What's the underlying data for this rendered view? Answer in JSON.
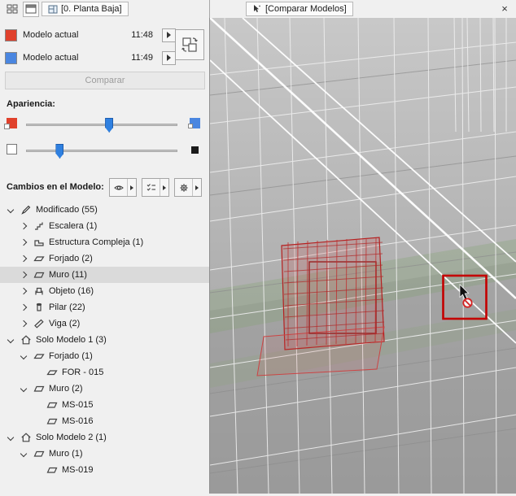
{
  "window": {
    "left_tab": "[0. Planta Baja]",
    "right_tab": "[Comparar Modelos]",
    "close_label": "×"
  },
  "models": {
    "rows": [
      {
        "name": "Modelo actual",
        "time": "11:48",
        "color": "#e0412c"
      },
      {
        "name": "Modelo actual",
        "time": "11:49",
        "color": "#4a86e0"
      }
    ],
    "compare_button": "Comparar"
  },
  "appearance": {
    "label": "Apariencia:",
    "thumb_color": "#2f80e0",
    "sliders": [
      {
        "name": "color-intensity",
        "value_pct": 55,
        "left_color": "#e0412c",
        "right_color": "#4a86e0"
      },
      {
        "name": "transparency",
        "value_pct": 22,
        "left_color": "#ffffff",
        "right_color": "#1a1a1a"
      }
    ]
  },
  "changes": {
    "label": "Cambios en el Modelo:",
    "buttons": [
      {
        "icon": "highlight-changes-icon"
      },
      {
        "icon": "list-filter-icon"
      },
      {
        "icon": "settings-gear-icon"
      }
    ]
  },
  "tree": {
    "items": [
      {
        "label": "Modificado (55)",
        "depth": 0,
        "expand": "expanded",
        "icon": "pencil-icon"
      },
      {
        "label": "Escalera (1)",
        "depth": 1,
        "expand": "collapsed",
        "icon": "stair-icon"
      },
      {
        "label": "Estructura Compleja (1)",
        "depth": 1,
        "expand": "collapsed",
        "icon": "complex-structure-icon"
      },
      {
        "label": "Forjado (2)",
        "depth": 1,
        "expand": "collapsed",
        "icon": "slab-icon"
      },
      {
        "label": "Muro (11)",
        "depth": 1,
        "expand": "collapsed",
        "icon": "wall-icon",
        "selected": true
      },
      {
        "label": "Objeto (16)",
        "depth": 1,
        "expand": "collapsed",
        "icon": "object-icon"
      },
      {
        "label": "Pilar (22)",
        "depth": 1,
        "expand": "collapsed",
        "icon": "column-icon"
      },
      {
        "label": "Viga (2)",
        "depth": 1,
        "expand": "collapsed",
        "icon": "beam-icon"
      },
      {
        "label": "Solo Modelo 1 (3)",
        "depth": 0,
        "expand": "expanded",
        "icon": "model-icon"
      },
      {
        "label": "Forjado (1)",
        "depth": 1,
        "expand": "expanded",
        "icon": "slab-icon"
      },
      {
        "label": "FOR - 015",
        "depth": 2,
        "expand": "none",
        "icon": "slab-icon"
      },
      {
        "label": "Muro (2)",
        "depth": 1,
        "expand": "expanded",
        "icon": "wall-icon"
      },
      {
        "label": "MS-015",
        "depth": 2,
        "expand": "none",
        "icon": "wall-icon"
      },
      {
        "label": "MS-016",
        "depth": 2,
        "expand": "none",
        "icon": "wall-icon"
      },
      {
        "label": "Solo Modelo 2 (1)",
        "depth": 0,
        "expand": "expanded",
        "icon": "model-icon"
      },
      {
        "label": "Muro (1)",
        "depth": 1,
        "expand": "expanded",
        "icon": "wall-icon"
      },
      {
        "label": "MS-019",
        "depth": 2,
        "expand": "none",
        "icon": "wall-icon"
      }
    ]
  },
  "viewport": {
    "selection_box_color": "#c40000",
    "change_highlight_color": "#c23030",
    "background_color": "#aeaeae"
  }
}
